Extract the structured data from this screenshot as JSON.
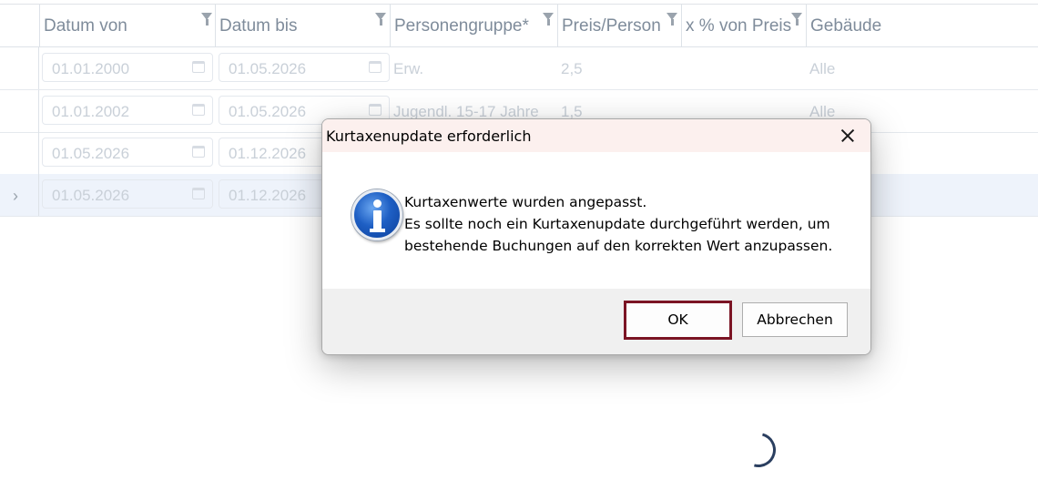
{
  "grid": {
    "columns": [
      {
        "label": "Datum von"
      },
      {
        "label": "Datum bis"
      },
      {
        "label": "Personengruppe*"
      },
      {
        "label": "Preis/Person"
      },
      {
        "label": "x % von Preis"
      },
      {
        "label": "Gebäude"
      }
    ],
    "rows": [
      {
        "von": "01.01.2000",
        "bis": "01.05.2026",
        "gruppe": "Erw.",
        "preis": "2,5",
        "gebaeude": "Alle"
      },
      {
        "von": "01.01.2002",
        "bis": "01.05.2026",
        "gruppe": "Jugendl. 15-17 Jahre",
        "preis": "1,5",
        "gebaeude": "Alle"
      },
      {
        "von": "01.05.2026",
        "bis": "01.12.2026",
        "gruppe": "",
        "preis": "",
        "gebaeude": ""
      },
      {
        "von": "01.05.2026",
        "bis": "01.12.2026",
        "gruppe": "",
        "preis": "",
        "gebaeude": ""
      }
    ]
  },
  "dialog": {
    "title": "Kurtaxenupdate erforderlich",
    "message_lines": [
      "Kurtaxenwerte wurden angepasst.",
      "Es sollte noch ein Kurtaxenupdate durchgeführt werden, um",
      "bestehende Buchungen auf den korrekten Wert anzupassen."
    ],
    "ok_label": "OK",
    "cancel_label": "Abbrechen",
    "icon": "information-icon"
  },
  "colors": {
    "ok_border": "#7b1424",
    "spinner": "#2b3f60",
    "title_bar": "#fcf0ee"
  }
}
